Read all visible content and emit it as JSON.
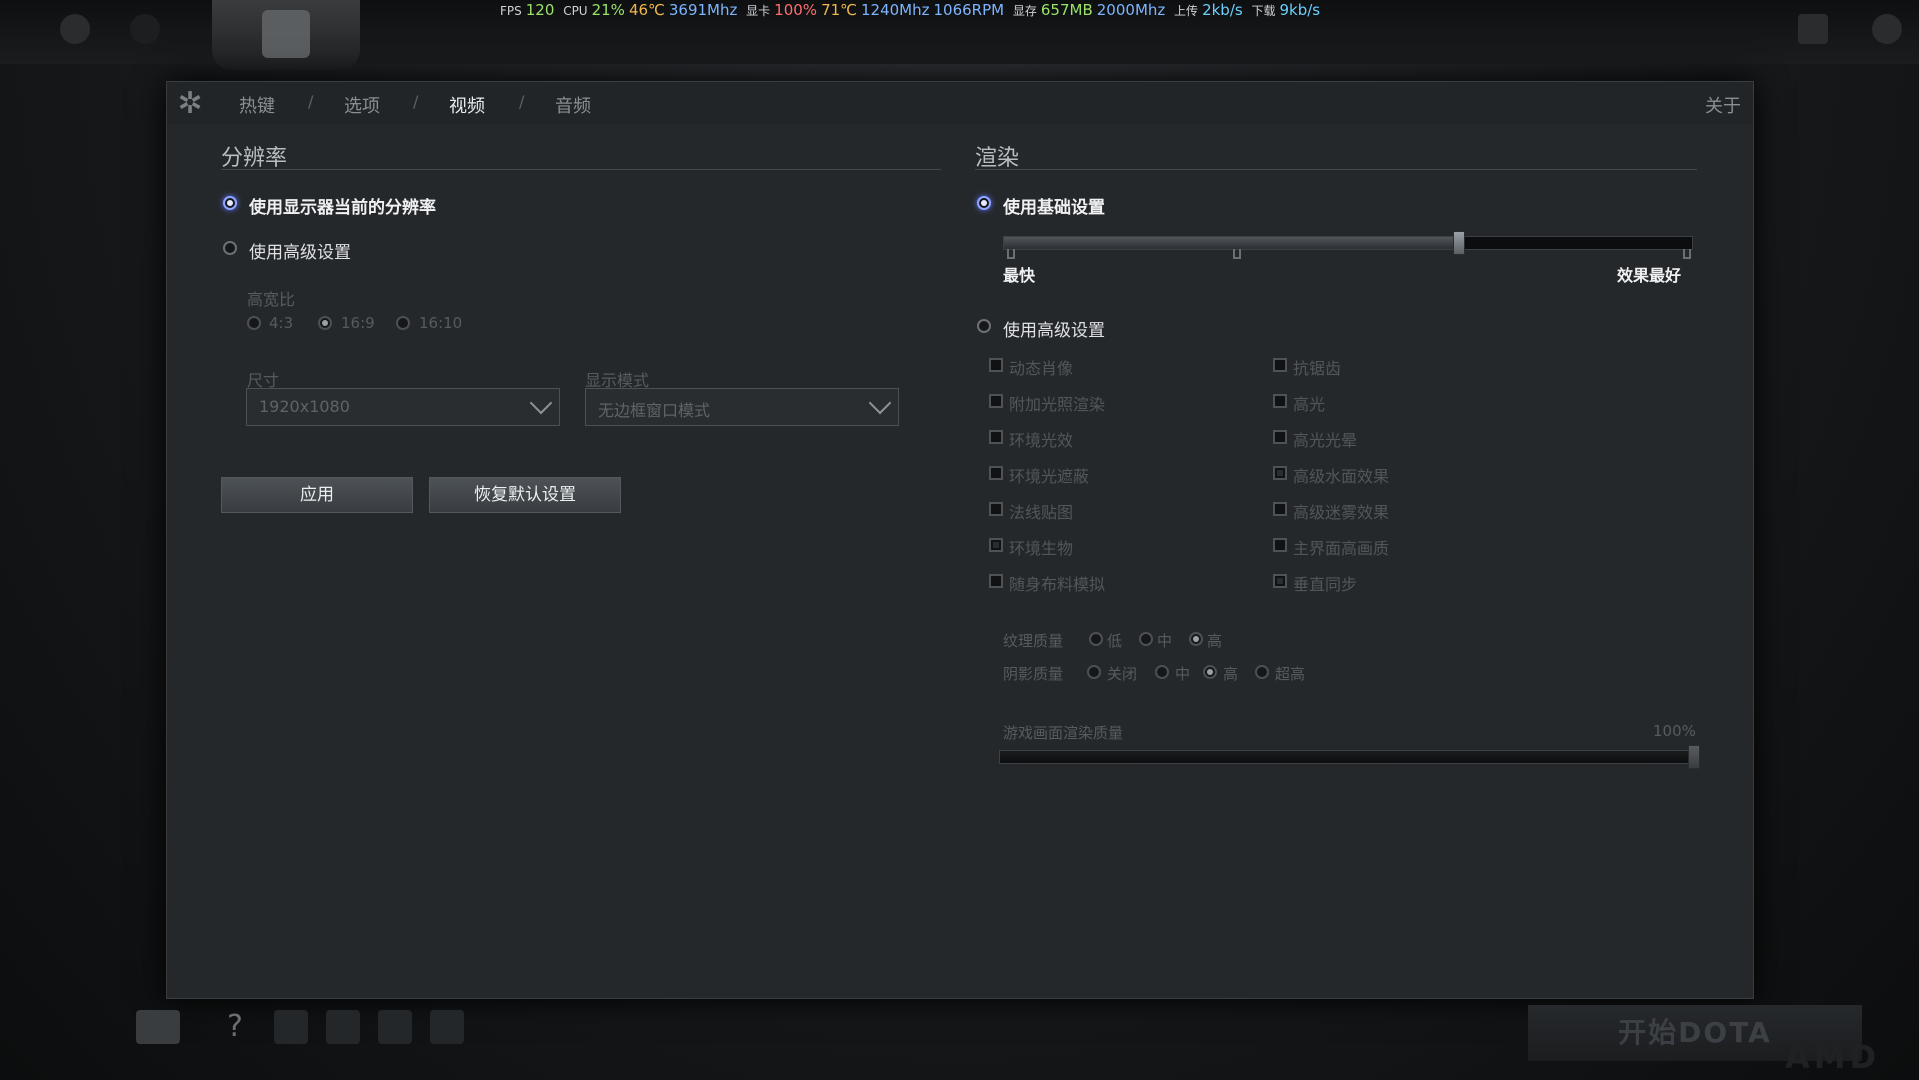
{
  "perf_overlay": {
    "fps_label": "FPS",
    "fps": "120",
    "cpu_label": "CPU",
    "cpu_pct": "21%",
    "cpu_temp": "46℃",
    "cpu_clock": "3691Mhz",
    "gpu_label": "显卡",
    "gpu_pct": "100%",
    "gpu_temp": "71℃",
    "gpu_clock": "1240Mhz",
    "fan": "1066RPM",
    "vram_label": "显存",
    "vram": "657MB",
    "vram_clock": "2000Mhz",
    "up_label": "上传",
    "up": "2kb/s",
    "down_label": "下载",
    "down": "9kb/s"
  },
  "tabs": {
    "hotkeys": "热键",
    "options": "选项",
    "video": "视频",
    "audio": "音频",
    "sep": "/",
    "about": "关于"
  },
  "resolution": {
    "title": "分辨率",
    "use_monitor": "使用显示器当前的分辨率",
    "use_advanced": "使用高级设置",
    "aspect_label": "高宽比",
    "aspect_43": "4:3",
    "aspect_169": "16:9",
    "aspect_1610": "16:10",
    "size_label": "尺寸",
    "size_value": "1920x1080",
    "mode_label": "显示模式",
    "mode_value": "无边框窗口模式",
    "apply": "应用",
    "restore": "恢复默认设置"
  },
  "render": {
    "title": "渲染",
    "use_basic": "使用基础设置",
    "slider_min": "最快",
    "slider_max": "效果最好",
    "quality_level": 0.66,
    "use_advanced": "使用高级设置",
    "left_checks": [
      "动态肖像",
      "附加光照渲染",
      "环境光效",
      "环境光遮蔽",
      "法线贴图",
      "环境生物",
      "随身布料模拟"
    ],
    "right_checks": [
      "抗锯齿",
      "高光",
      "高光光晕",
      "高级水面效果",
      "高级迷雾效果",
      "主界面高画质",
      "垂直同步"
    ],
    "texture_label": "纹理质量",
    "tex_low": "低",
    "tex_mid": "中",
    "tex_high": "高",
    "shadow_label": "阴影质量",
    "sh_off": "关闭",
    "sh_mid": "中",
    "sh_high": "高",
    "sh_ultra": "超高",
    "render_quality_label": "游戏画面渲染质量",
    "render_quality_value": "100%"
  },
  "footer": {
    "start_button": "开始DOTA",
    "watermark": "AMD"
  }
}
